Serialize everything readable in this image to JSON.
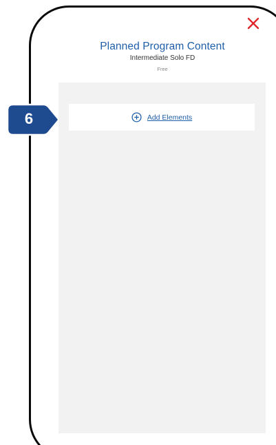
{
  "dialog": {
    "title": "Planned Program Content",
    "subtitle": "Intermediate Solo FD",
    "tag": "Free",
    "close_icon": "close-icon",
    "close_color": "#e0262d"
  },
  "content": {
    "add_elements_label": "Add Elements",
    "add_icon": "plus-circle-icon",
    "accent_color": "#1f5ea8"
  },
  "callout": {
    "step": "6",
    "color": "#1e4b8f"
  }
}
